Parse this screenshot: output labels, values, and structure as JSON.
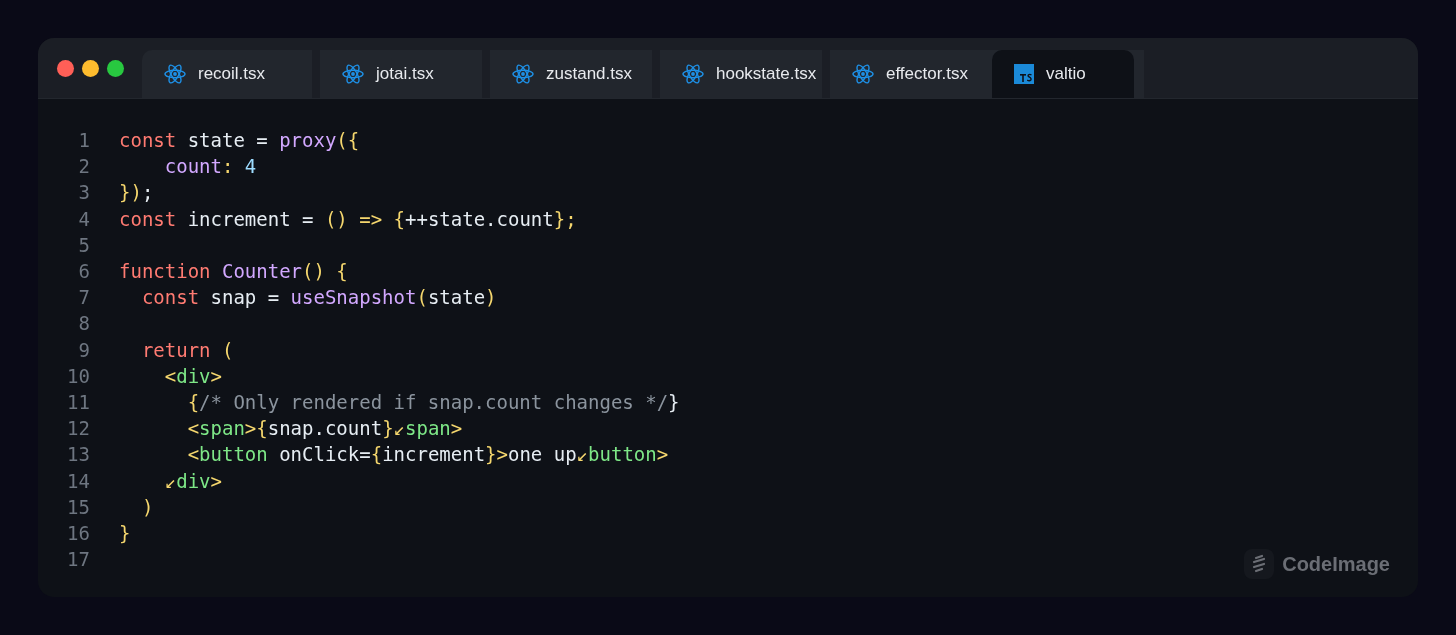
{
  "window": {
    "controls": [
      {
        "kind": "close"
      },
      {
        "kind": "minimize"
      },
      {
        "kind": "maximize"
      }
    ]
  },
  "tabs": [
    {
      "label": "recoil.tsx",
      "kind": "react",
      "selected": false
    },
    {
      "label": "jotai.tsx",
      "kind": "react",
      "selected": false
    },
    {
      "label": "zustand.tsx",
      "kind": "react",
      "selected": false
    },
    {
      "label": "hookstate.tsx",
      "kind": "react",
      "selected": false
    },
    {
      "label": "effector.tsx",
      "kind": "react",
      "selected": false
    },
    {
      "label": "valtio",
      "kind": "typescript",
      "selected": true
    }
  ],
  "code": [
    {
      "number": "1",
      "tokens": [
        {
          "kind": "keyword",
          "text": "const"
        },
        {
          "kind": "plain",
          "text": " state = "
        },
        {
          "kind": "function",
          "text": "proxy"
        },
        {
          "kind": "punct",
          "text": "({"
        }
      ]
    },
    {
      "number": "2",
      "tokens": [
        {
          "kind": "function",
          "text": "    count"
        },
        {
          "kind": "punct",
          "text": ":"
        },
        {
          "kind": "number",
          "text": " 4"
        }
      ]
    },
    {
      "number": "3",
      "tokens": [
        {
          "kind": "punct",
          "text": "})"
        },
        {
          "kind": "plain",
          "text": ";"
        }
      ]
    },
    {
      "number": "4",
      "tokens": [
        {
          "kind": "keyword",
          "text": "const"
        },
        {
          "kind": "plain",
          "text": " increment = "
        },
        {
          "kind": "punct",
          "text": "() => {"
        },
        {
          "kind": "plain",
          "text": "++state.count"
        },
        {
          "kind": "punct",
          "text": "};"
        }
      ]
    },
    {
      "number": "5"
    },
    {
      "number": "6",
      "tokens": [
        {
          "kind": "keyword",
          "text": "function"
        },
        {
          "kind": "function",
          "text": " Counter"
        },
        {
          "kind": "punct",
          "text": "() {"
        }
      ]
    },
    {
      "number": "7",
      "tokens": [
        {
          "kind": "keyword",
          "text": "  const"
        },
        {
          "kind": "plain",
          "text": " snap = "
        },
        {
          "kind": "function",
          "text": "useSnapshot"
        },
        {
          "kind": "punct",
          "text": "("
        },
        {
          "kind": "plain",
          "text": "state"
        },
        {
          "kind": "punct",
          "text": ")"
        }
      ]
    },
    {
      "number": "8"
    },
    {
      "number": "9",
      "tokens": [
        {
          "kind": "keyword",
          "text": "  return"
        },
        {
          "kind": "punct",
          "text": " ("
        }
      ]
    },
    {
      "number": "10",
      "tokens": [
        {
          "kind": "punct",
          "text": "    <"
        },
        {
          "kind": "tag",
          "text": "div"
        },
        {
          "kind": "punct",
          "text": ">"
        }
      ]
    },
    {
      "number": "11",
      "tokens": [
        {
          "kind": "punct",
          "text": "      {"
        },
        {
          "kind": "comment",
          "text": "/* Only rendered if snap.count changes */"
        },
        {
          "kind": "plain",
          "text": "}"
        }
      ]
    },
    {
      "number": "12",
      "tokens": [
        {
          "kind": "punct",
          "text": "      <"
        },
        {
          "kind": "tag",
          "text": "span"
        },
        {
          "kind": "punct",
          "text": ">{"
        },
        {
          "kind": "plain",
          "text": "snap.count"
        },
        {
          "kind": "punct",
          "text": "}↙"
        },
        {
          "kind": "tag",
          "text": "span"
        },
        {
          "kind": "punct",
          "text": ">"
        }
      ]
    },
    {
      "number": "13",
      "tokens": [
        {
          "kind": "punct",
          "text": "      <"
        },
        {
          "kind": "tag",
          "text": "button"
        },
        {
          "kind": "plain",
          "text": " onClick="
        },
        {
          "kind": "punct",
          "text": "{"
        },
        {
          "kind": "plain",
          "text": "increment"
        },
        {
          "kind": "punct",
          "text": "}>"
        },
        {
          "kind": "plain",
          "text": "one up"
        },
        {
          "kind": "punct",
          "text": "↙"
        },
        {
          "kind": "tag",
          "text": "button"
        },
        {
          "kind": "punct",
          "text": ">"
        }
      ]
    },
    {
      "number": "14",
      "tokens": [
        {
          "kind": "punct",
          "text": "    ↙"
        },
        {
          "kind": "tag",
          "text": "div"
        },
        {
          "kind": "punct",
          "text": ">"
        }
      ]
    },
    {
      "number": "15",
      "tokens": [
        {
          "kind": "punct",
          "text": "  )"
        }
      ]
    },
    {
      "number": "16",
      "tokens": [
        {
          "kind": "punct",
          "text": "}"
        }
      ]
    },
    {
      "number": "17"
    }
  ],
  "branding": {
    "label": "CodeImage"
  }
}
